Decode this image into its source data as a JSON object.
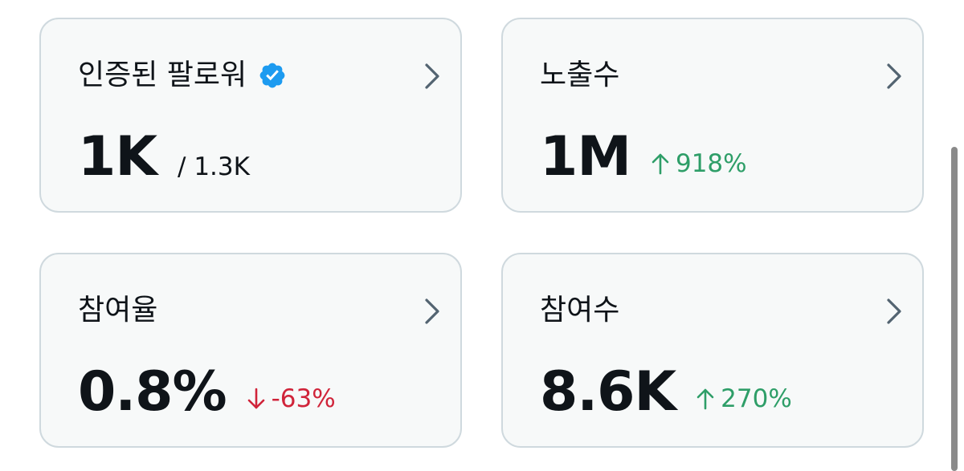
{
  "cards": [
    {
      "label": "인증된 팔로워",
      "value": "1K",
      "total": "/ 1.3K",
      "verified_icon": "verified-badge-icon",
      "verified_color": "#1d9bf0"
    },
    {
      "label": "노출수",
      "value": "1M",
      "delta": "918%",
      "delta_direction": "up"
    },
    {
      "label": "참여율",
      "value": "0.8%",
      "delta": "-63%",
      "delta_direction": "down"
    },
    {
      "label": "참여수",
      "value": "8.6K",
      "delta": "270%",
      "delta_direction": "up"
    }
  ],
  "colors": {
    "card_bg": "#f7f9f9",
    "card_border": "#cfd9de",
    "positive": "#2e9e68",
    "negative": "#d0243a",
    "text": "#0f1419",
    "chevron": "#536471"
  },
  "icons": {
    "chevron": "chevron-right-icon",
    "up": "arrow-up-icon",
    "down": "arrow-down-icon"
  }
}
